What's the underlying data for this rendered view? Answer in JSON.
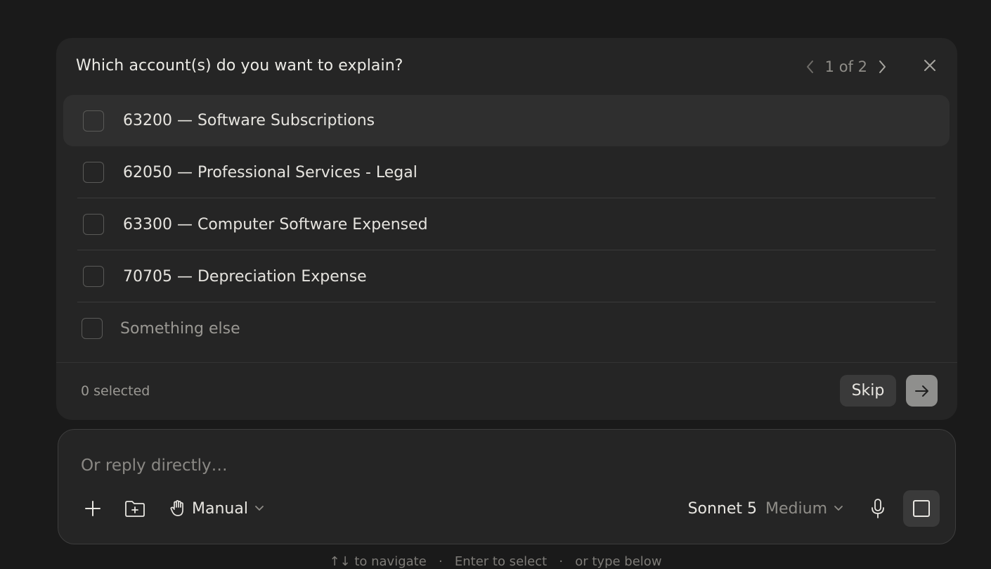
{
  "question": {
    "title": "Which account(s) do you want to explain?",
    "pager": "1 of 2"
  },
  "options": [
    {
      "label": "63200 — Software Subscriptions",
      "checked": false
    },
    {
      "label": "62050 — Professional Services - Legal",
      "checked": false
    },
    {
      "label": "63300 — Computer Software Expensed",
      "checked": false
    },
    {
      "label": "70705 — Depreciation Expense",
      "checked": false
    },
    {
      "label": "Something else",
      "checked": false
    }
  ],
  "footer": {
    "selected_count": "0 selected",
    "skip_label": "Skip"
  },
  "composer": {
    "placeholder": "Or reply directly…",
    "mode_label": "Manual",
    "model_name": "Sonnet 5",
    "model_effort": "Medium"
  },
  "hint": {
    "navigate": "↑↓ to navigate",
    "select": "Enter to select",
    "type": "or type below"
  },
  "icons": {
    "prev": "chevron-left-icon",
    "next": "chevron-right-icon",
    "close": "close-icon",
    "submit": "arrow-right-icon",
    "add": "plus-icon",
    "folder": "folder-plus-icon",
    "mode": "hand-icon",
    "mic": "microphone-icon",
    "stop": "stop-square-icon"
  }
}
